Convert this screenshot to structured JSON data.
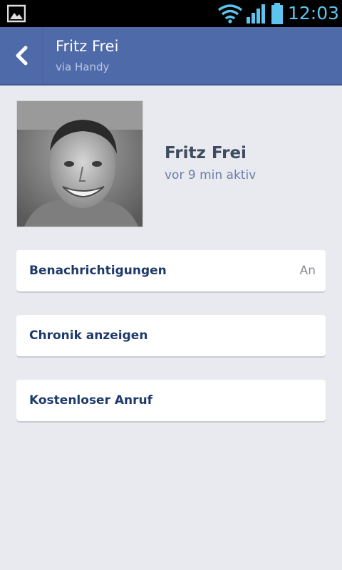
{
  "status_bar": {
    "time": "12:03",
    "icons": [
      "gallery-icon",
      "wifi-icon",
      "signal-icon",
      "battery-icon"
    ],
    "accent_color": "#5cc4ee"
  },
  "header": {
    "title": "Fritz Frei",
    "subtitle": "via Handy",
    "back_icon": "chevron-left-icon",
    "background_color": "#4f6aa8"
  },
  "profile": {
    "name": "Fritz Frei",
    "status": "vor 9 min aktiv",
    "avatar_icon": "profile-photo"
  },
  "options": [
    {
      "label": "Benachrichtigungen",
      "value": "An"
    },
    {
      "label": "Chronik anzeigen",
      "value": ""
    },
    {
      "label": "Kostenloser Anruf",
      "value": ""
    }
  ]
}
